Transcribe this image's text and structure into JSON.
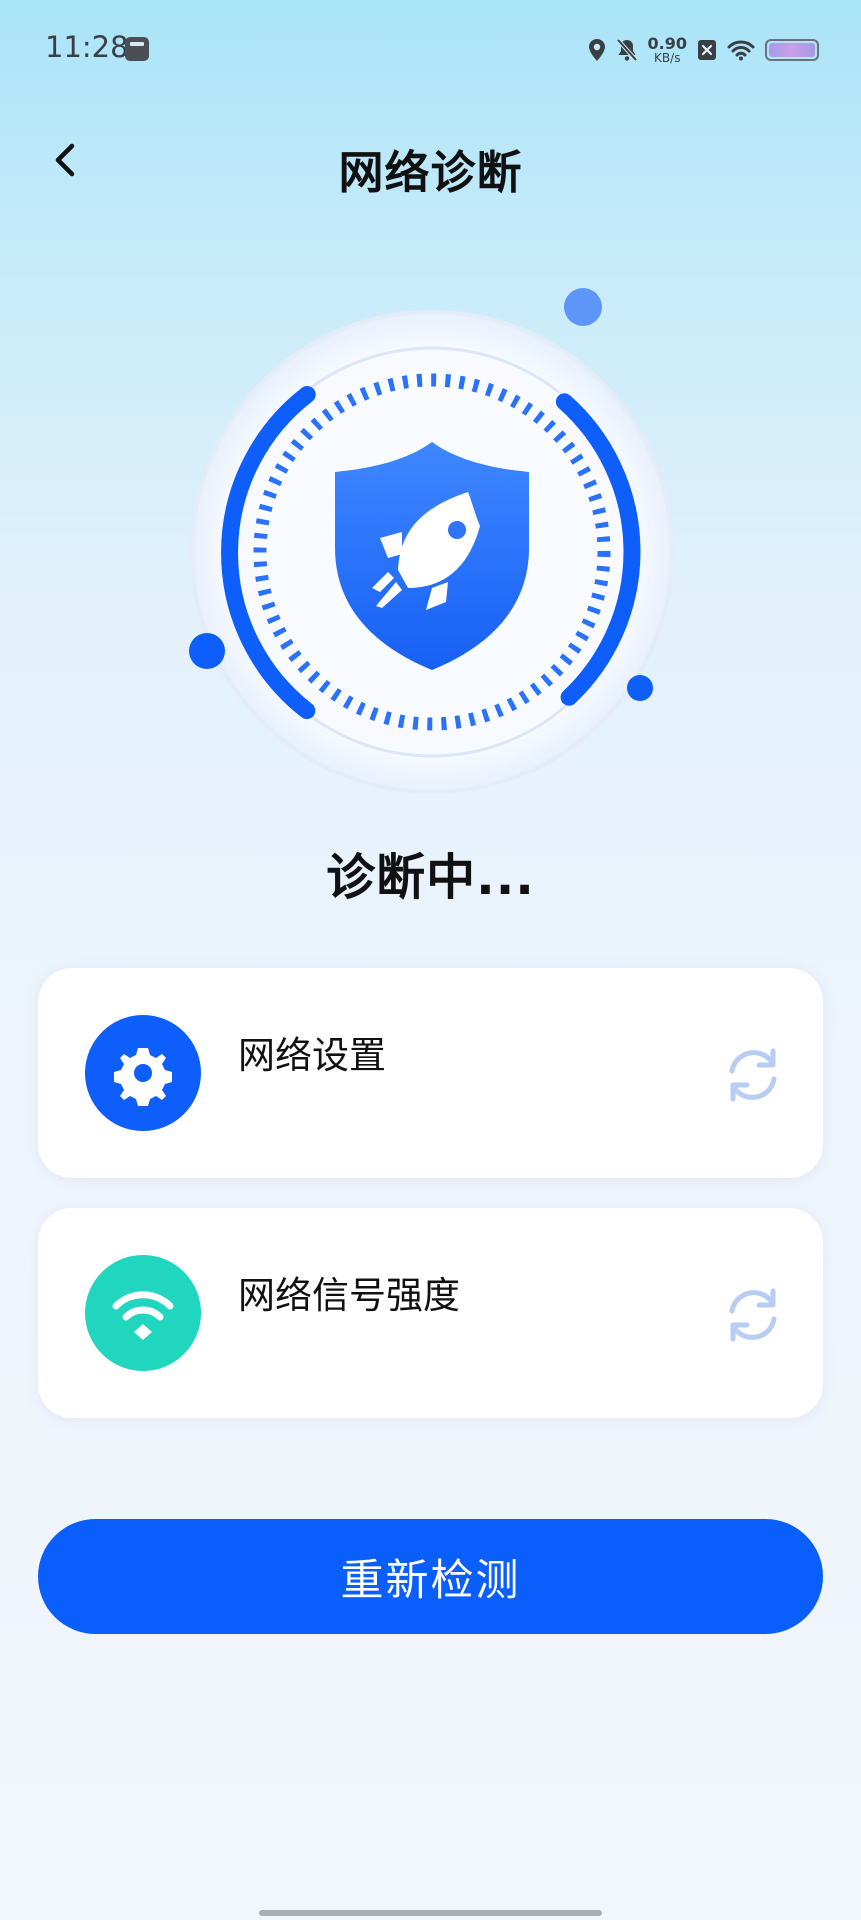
{
  "status_bar": {
    "time": "11:28",
    "net_speed_value": "0.90",
    "net_speed_unit": "KB/s",
    "icons": [
      "calendar-app-icon",
      "location-icon",
      "bell-muted-icon",
      "sim-blocked-icon",
      "wifi-icon",
      "battery-icon"
    ]
  },
  "header": {
    "title": "网络诊断",
    "back_icon": "chevron-left-icon"
  },
  "hero": {
    "icon": "shield-rocket-icon",
    "status_text": "诊断中..."
  },
  "items": [
    {
      "label": "网络设置",
      "icon": "gear-icon",
      "icon_bg": "#0d5efb",
      "state_icon": "refresh-icon"
    },
    {
      "label": "网络信号强度",
      "icon": "wifi-icon",
      "icon_bg": "#20d6bf",
      "state_icon": "refresh-icon"
    }
  ],
  "actions": {
    "retest_label": "重新检测"
  },
  "colors": {
    "accent": "#0a5efb",
    "teal": "#20d6bf",
    "refresh": "#b8cdf3"
  }
}
